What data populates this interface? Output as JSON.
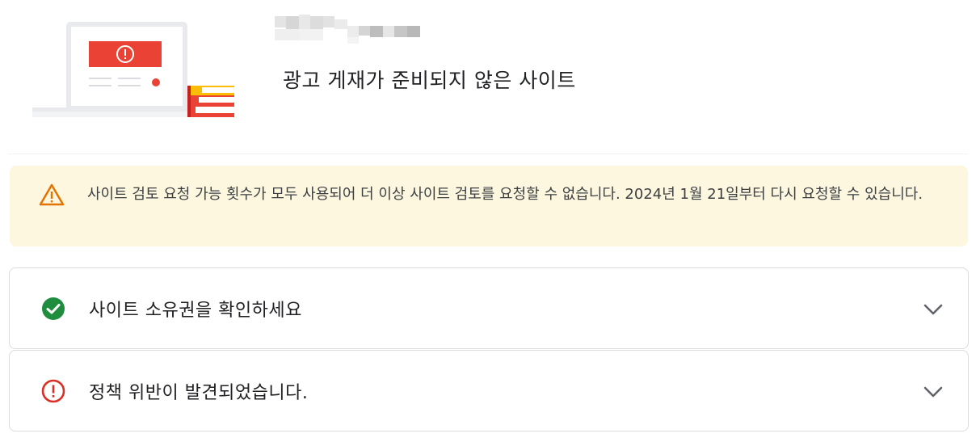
{
  "header": {
    "title": "광고 게재가 준비되지 않은 사이트"
  },
  "warning": {
    "icon": "warning-triangle-icon",
    "color": "#e37400",
    "message": "사이트 검토 요청 가능 횟수가 모두 사용되어 더 이상 사이트 검토를 요청할 수 없습니다. 2024년 1월 21일부터 다시 요청할 수 있습니다."
  },
  "checklist": [
    {
      "label": "사이트 소유권을 확인하세요",
      "status": "success",
      "icon": "check-circle-icon",
      "color": "#1e8e3e"
    },
    {
      "label": "정책 위반이 발견되었습니다.",
      "status": "error",
      "icon": "error-circle-icon",
      "color": "#d93025"
    }
  ],
  "colors": {
    "warning_background": "#fdf7e0",
    "error_red": "#ea4335"
  }
}
